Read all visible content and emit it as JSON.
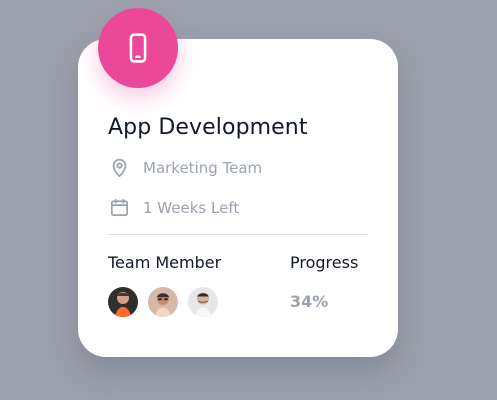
{
  "card": {
    "title": "App Development",
    "location": "Marketing Team",
    "timeframe": "1 Weeks Left",
    "team_label": "Team Member",
    "progress_label": "Progress",
    "progress_value": "34%",
    "progress_fraction": 0.34,
    "icons": {
      "badge": "smartphone-icon",
      "location": "location-pin-icon",
      "time": "calendar-icon"
    },
    "colors": {
      "accent": "#ec4899",
      "muted": "#9ca3af",
      "text": "#111827",
      "background": "#9aa1ad"
    }
  }
}
